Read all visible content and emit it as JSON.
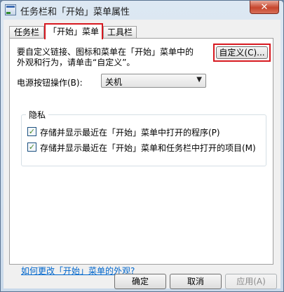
{
  "window": {
    "title": "任务栏和「开始」菜单属性",
    "close_label": "✕"
  },
  "tabs": [
    {
      "label": "任务栏"
    },
    {
      "label": "「开始」菜单"
    },
    {
      "label": "工具栏"
    }
  ],
  "start_menu": {
    "description_line1": "要自定义链接、图标和菜单在「开始」菜单中的",
    "description_line2": "外观和行为，请单击“自定义”。",
    "customize_label": "自定义(C)...",
    "power_label": "电源按钮操作(B):",
    "power_value": "关机",
    "privacy_title": "隐私",
    "privacy_options": [
      {
        "label": "存储并显示最近在「开始」菜单中打开的程序(P)",
        "checked": true
      },
      {
        "label": "存储并显示最近在「开始」菜单和任务栏中打开的项目(M)",
        "checked": true
      }
    ],
    "help_link": "如何更改「开始」菜单的外观?"
  },
  "footer": {
    "ok_label": "确定",
    "cancel_label": "取消",
    "apply_label": "应用(A)"
  },
  "colors": {
    "highlight_border": "#d71920",
    "link": "#0066cc"
  }
}
